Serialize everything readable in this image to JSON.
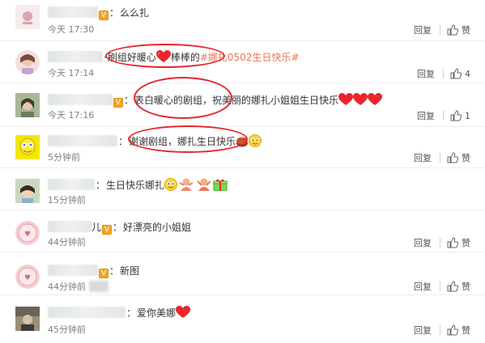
{
  "colors": {
    "accent_red": "#e8262c",
    "topic": "#eb7350",
    "time_gray": "#808080",
    "heart": "#e8262c"
  },
  "comments": [
    {
      "text": "么么扎",
      "time": "今天 17:30",
      "reply": "回复",
      "like": "赞",
      "like_count": ""
    },
    {
      "text": "刷组好暖心",
      "text2": "棒棒的",
      "topic": "#娜扎0502生日快乐#",
      "time": "今天 17:14",
      "reply": "回复",
      "like": "",
      "like_count": "4"
    },
    {
      "text": "表白暖心的剧组，祝美丽的娜扎小姐姐生日快乐",
      "time": "今天 17:16",
      "reply": "回复",
      "like": "",
      "like_count": "1"
    },
    {
      "text": "谢谢剧组，娜扎生日快乐",
      "time": "5分钟前",
      "reply": "回复",
      "like": "赞",
      "like_count": ""
    },
    {
      "text": "生日快乐娜扎",
      "time": "15分钟前",
      "reply": "回复",
      "like": "赞",
      "like_count": ""
    },
    {
      "name_suffix": "儿",
      "text": "好漂亮的小姐姐",
      "time": "44分钟前",
      "reply": "回复",
      "like": "赞",
      "like_count": ""
    },
    {
      "text": "新图",
      "time": "44分钟前",
      "reply": "回复",
      "like": "赞",
      "like_count": ""
    },
    {
      "text": "爱你美娜",
      "time": "45分钟前",
      "reply": "回复",
      "like": "赞",
      "like_count": ""
    }
  ]
}
